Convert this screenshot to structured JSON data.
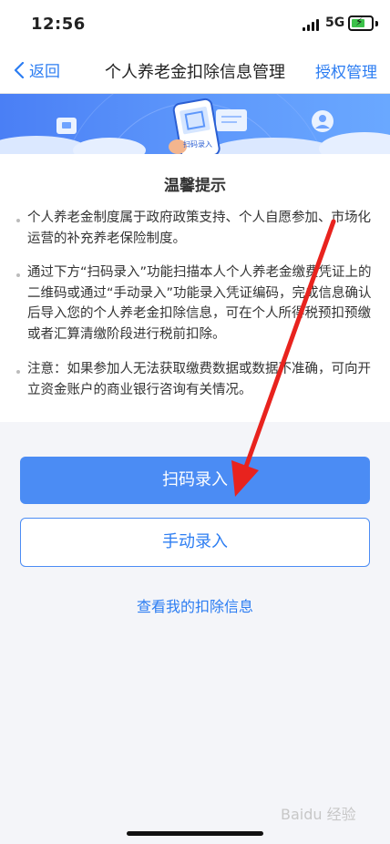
{
  "status": {
    "time": "12:56",
    "network": "5G"
  },
  "nav": {
    "back_label": "返回",
    "title": "个人养老金扣除信息管理",
    "right_label": "授权管理"
  },
  "banner": {
    "phone_text": "扫码录入"
  },
  "tips": {
    "heading": "温馨提示",
    "items": [
      {
        "text": "个人养老金制度属于政府政策支持、个人自愿参加、市场化运营的补充养老保险制度。"
      },
      {
        "text": "通过下方“扫码录入”功能扫描本人个人养老金缴费凭证上的二维码或通过“手动录入”功能录入凭证编码，完成信息确认后导入您的个人养老金扣除信息，可在个人所得税预扣预缴或者汇算清缴阶段进行税前扣除。"
      },
      {
        "text": "注意：如果参加人无法获取缴费数据或数据不准确，可向开立资金账户的商业银行咨询有关情况。"
      }
    ]
  },
  "actions": {
    "scan_label": "扫码录入",
    "manual_label": "手动录入",
    "view_link": "查看我的扣除信息"
  },
  "watermark": "Baidu 经验",
  "colors": {
    "accent": "#2c7df2",
    "button": "#4b8cf4",
    "annotation_arrow": "#e8231e"
  }
}
